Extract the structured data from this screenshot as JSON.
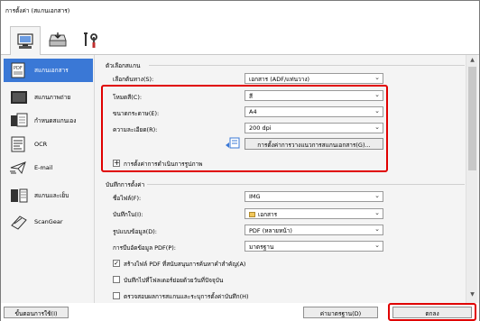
{
  "window": {
    "title": "การตั้งค่า (สแกนเอกสาร)"
  },
  "top_tabs": [
    {
      "name": "scan-from-computer-tab",
      "icon": "computer-scan-icon"
    },
    {
      "name": "scan-from-operation-panel-tab",
      "icon": "scanner-panel-icon"
    },
    {
      "name": "general-settings-tab",
      "icon": "tools-icon"
    }
  ],
  "sidebar": {
    "items": [
      {
        "label": "สแกนเอกสาร",
        "icon": "document-scan-icon",
        "active": true
      },
      {
        "label": "สแกนภาพถ่าย",
        "icon": "photo-scan-icon",
        "active": false
      },
      {
        "label": "กำหนดสแกนเอง",
        "icon": "custom-scan-icon",
        "active": false
      },
      {
        "label": "OCR",
        "icon": "ocr-icon",
        "active": false
      },
      {
        "label": "E-mail",
        "icon": "email-icon",
        "active": false
      },
      {
        "label": "สแกนและเย็บ",
        "icon": "stitch-icon",
        "active": false
      },
      {
        "label": "ScanGear",
        "icon": "scangear-icon",
        "active": false
      }
    ]
  },
  "scan_options": {
    "group_title": "ตัวเลือกสแกน",
    "source_label": "เลือกต้นทาง(S):",
    "source_value": "เอกสาร (ADF/แท่นวาง)",
    "color_mode_label": "โหมดสี(C):",
    "color_mode_value": "สี",
    "paper_size_label": "ขนาดกระดาษ(E):",
    "paper_size_value": "A4",
    "resolution_label": "ความละเอียด(R):",
    "resolution_value": "200 dpi",
    "document_scan_settings_button": "การตั้งค่าการวางแนวการสแกนเอกสาร(G)...",
    "image_processing_label": "การตั้งค่าการดำเนินการรูปภาพ",
    "expand_symbol": "+"
  },
  "save_settings": {
    "group_title": "บันทึกการตั้งค่า",
    "file_name_label": "ชื่อไฟล์(F):",
    "file_name_value": "IMG",
    "save_in_label": "บันทึกใน(I):",
    "save_in_value": "เอกสาร",
    "data_format_label": "รูปแบบข้อมูล(D):",
    "data_format_value": "PDF (หลายหน้า)",
    "pdf_compression_label": "การบีบอัดข้อมูล PDF(P):",
    "pdf_compression_value": "มาตรฐาน",
    "checkbox_searchable_pdf": "สร้างไฟล์ PDF ที่สนับสนุนการค้นหาคำสำคัญ(A)",
    "checkbox_searchable_pdf_checked": true,
    "checkbox_subfolder": "บันทึกไปที่โฟลเดอร์ย่อยด้วยวันที่ปัจจุบัน",
    "checkbox_subfolder_checked": false,
    "checkbox_check_results": "ตรวจสอบผลการสแกนและระบุการตั้งค่าบันทึก(H)",
    "checkbox_check_results_checked": false
  },
  "footer": {
    "instructions_button": "ขั้นตอนการใช้(I)",
    "defaults_button": "ค่ามาตรฐาน(D)",
    "ok_button": "ตกลง"
  },
  "colors": {
    "accent": "#3a78d6",
    "highlight": "#e00000",
    "panel_bg": "#f4f4f4"
  }
}
